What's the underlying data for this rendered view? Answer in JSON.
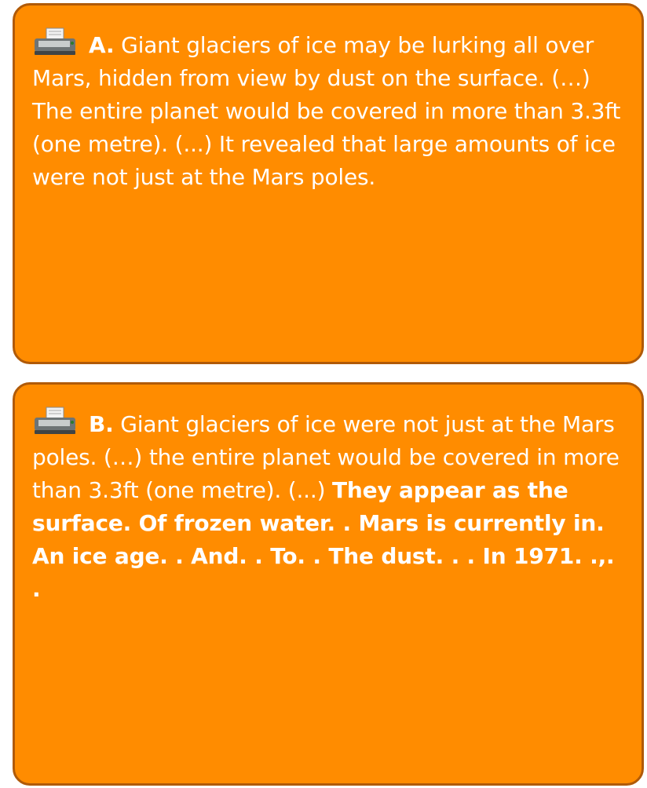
{
  "cards": [
    {
      "icon": "printer-icon",
      "label": "A.",
      "text": "Giant glaciers of ice may be lurking all over Mars, hidden from view by dust on the surface. (…) The entire planet would be covered in more than 3.3ft (one metre). (...) It revealed that large amounts of ice were not just at the Mars poles."
    },
    {
      "icon": "printer-icon",
      "label": "B.",
      "text": "Giant glaciers of ice were not just at the Mars poles. (…) the entire planet would be covered in more than 3.3ft (one metre). (...)",
      "bold_text": "They appear as the surface. Of frozen water. . Mars is currently in. An ice age. . And. . To. . The dust. . . In 1971. .,. ."
    }
  ],
  "colors": {
    "card_fill": "#ff8c00",
    "card_border": "#b05a08",
    "text": "#ffffff"
  }
}
